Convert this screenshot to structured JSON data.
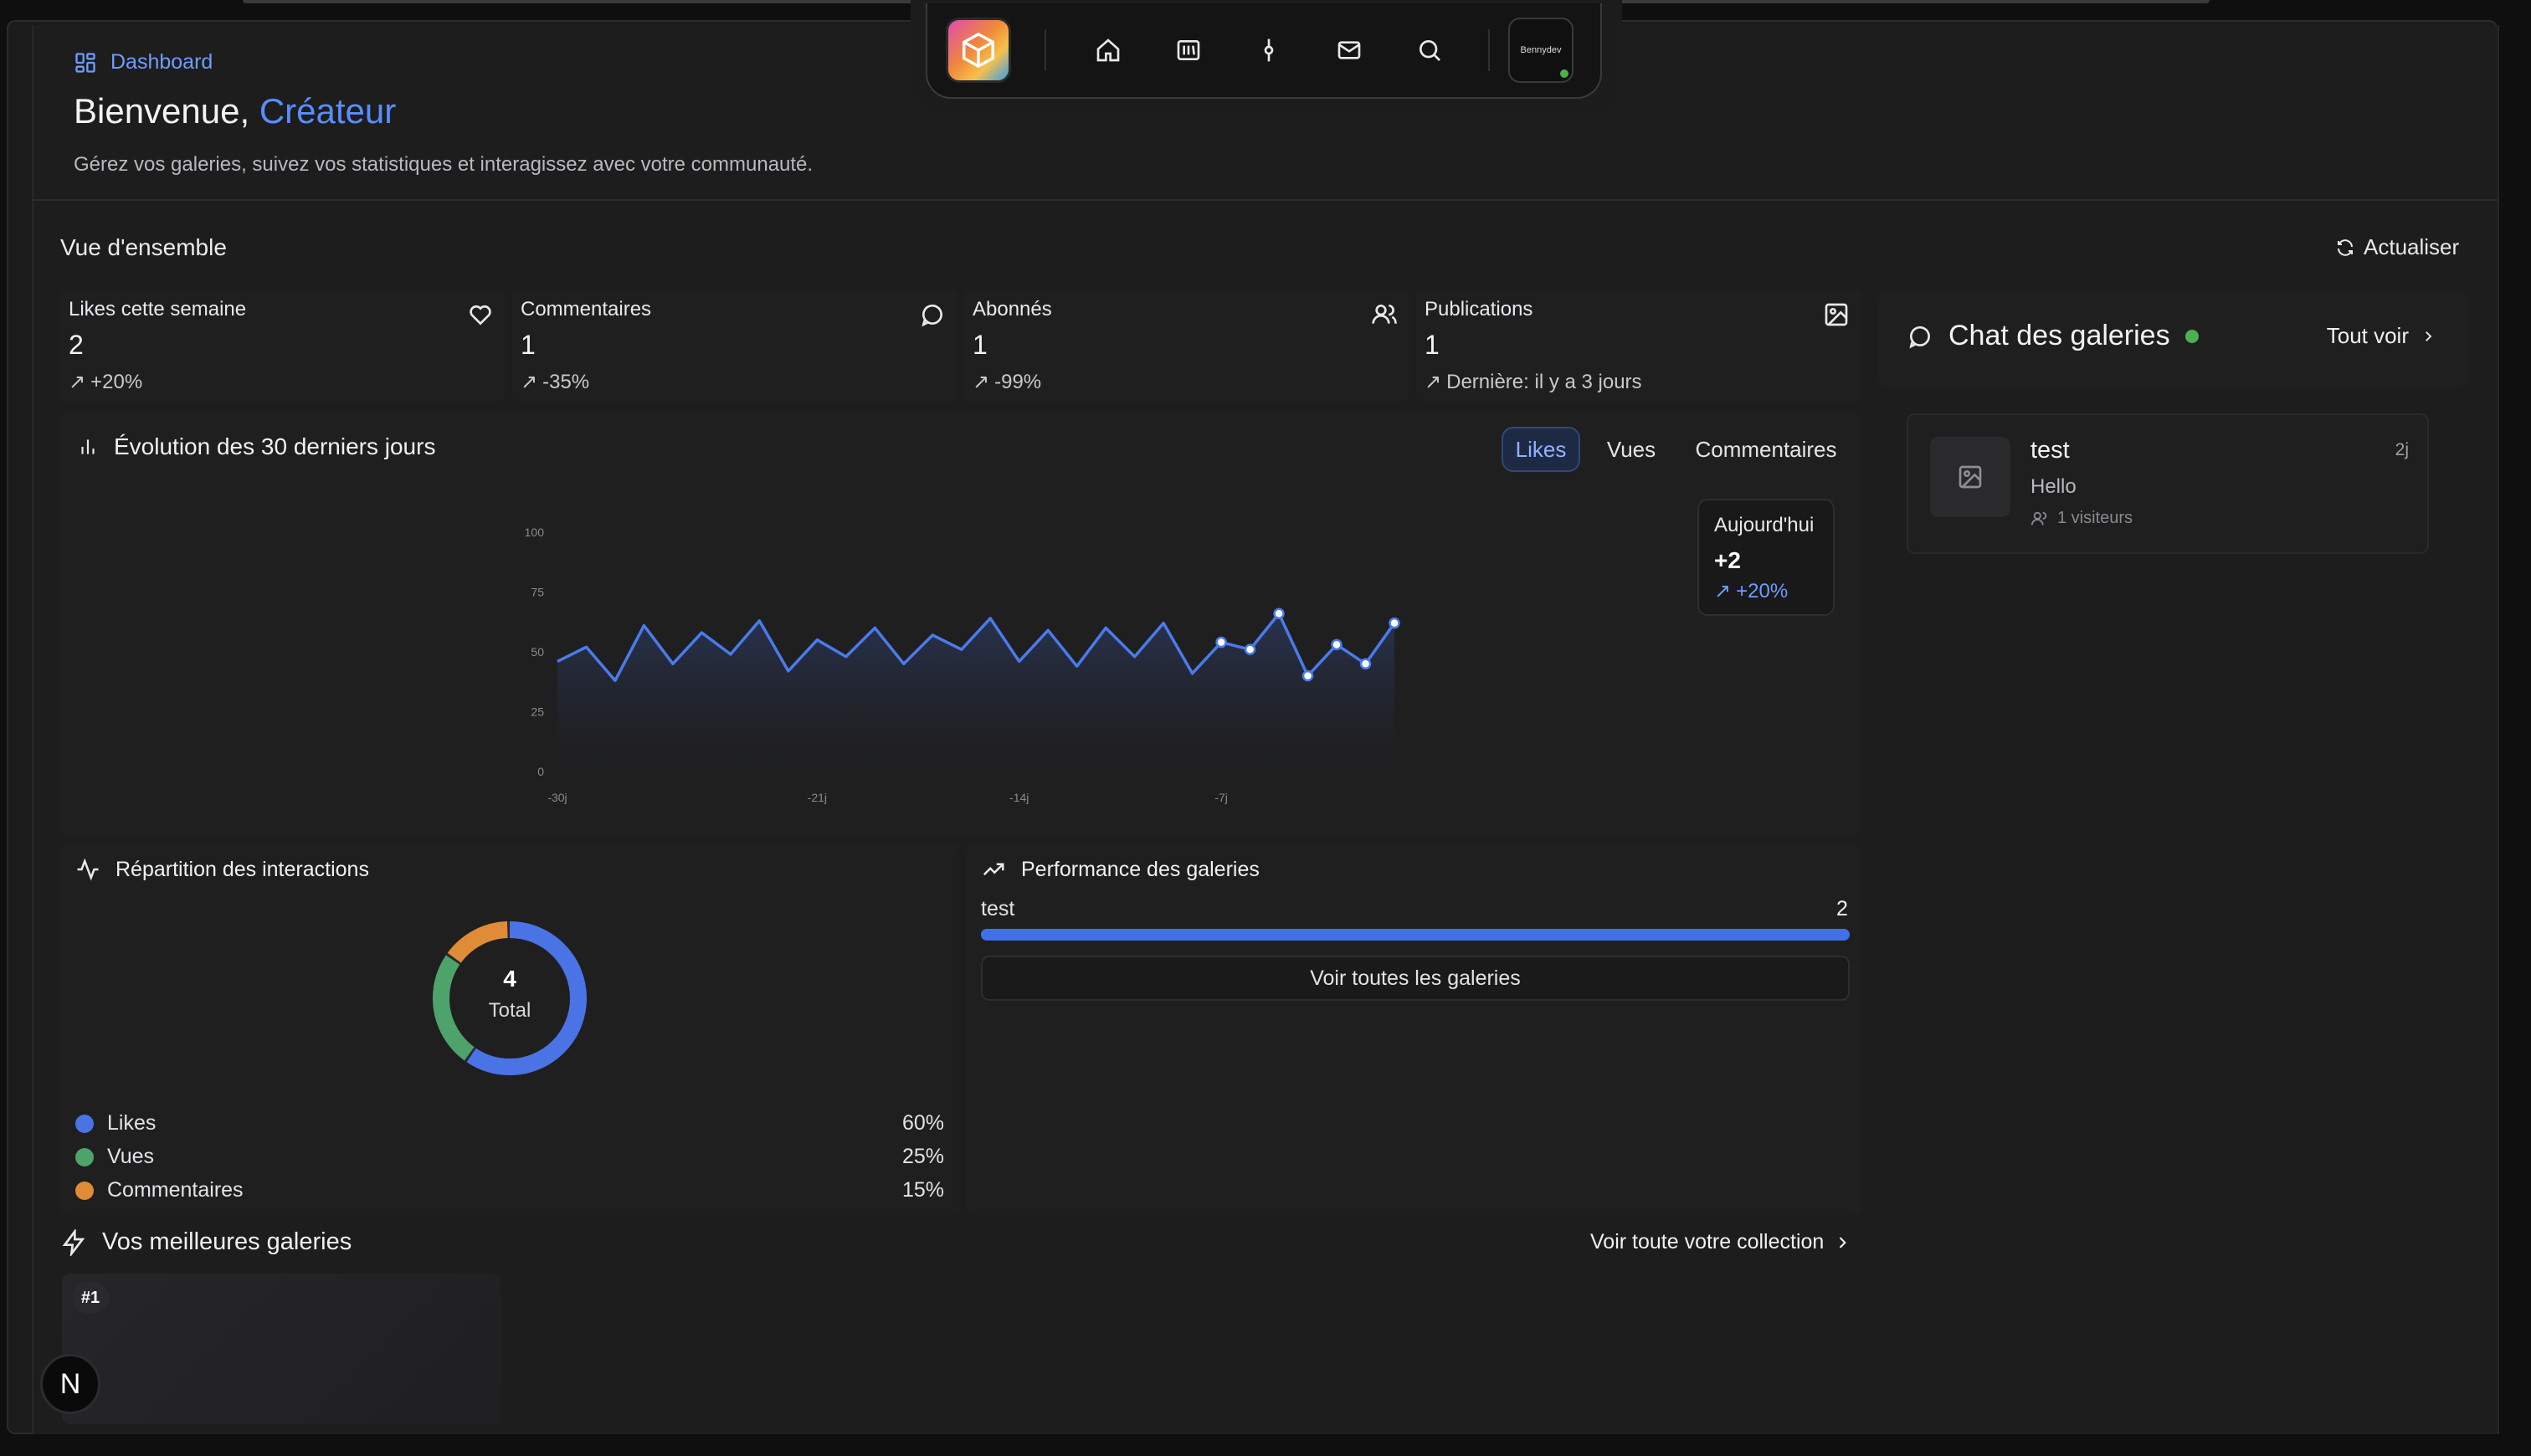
{
  "breadcrumb": {
    "label": "Dashboard"
  },
  "header": {
    "welcome_prefix": "Bienvenue,",
    "welcome_name": "Créateur",
    "subtitle": "Gérez vos galeries, suivez vos statistiques et interagissez avec votre communauté."
  },
  "dock": {
    "items": [
      "home-icon",
      "library-icon",
      "commit-icon",
      "mail-icon",
      "search-icon"
    ],
    "avatar_text": "Bennydev"
  },
  "overview": {
    "title": "Vue d'ensemble",
    "refresh_label": "Actualiser"
  },
  "stats": [
    {
      "label": "Likes cette semaine",
      "value": "2",
      "delta": "+20%",
      "icon": "heart-icon"
    },
    {
      "label": "Commentaires",
      "value": "1",
      "delta": "-35%",
      "icon": "comment-icon"
    },
    {
      "label": "Abonnés",
      "value": "1",
      "delta": "-99%",
      "icon": "users-icon"
    },
    {
      "label": "Publications",
      "value": "1",
      "delta": "Dernière: il y a 3 jours",
      "icon": "image-icon"
    }
  ],
  "evolution": {
    "title": "Évolution des 30 derniers jours",
    "tabs": [
      "Likes",
      "Vues",
      "Commentaires"
    ],
    "active_tab": "Likes",
    "today": {
      "label": "Aujourd'hui",
      "value": "+2",
      "delta": "+20%"
    }
  },
  "chart_data": {
    "type": "area",
    "title": "",
    "xlabel": "",
    "ylabel": "",
    "ylim": [
      0,
      100
    ],
    "y_ticks": [
      "0",
      "25",
      "50",
      "75",
      "100"
    ],
    "x_ticks": [
      {
        "label": "-30j",
        "x": 0
      },
      {
        "label": "-21j",
        "x": 9
      },
      {
        "label": "-14j",
        "x": 16
      },
      {
        "label": "-7j",
        "x": 23
      }
    ],
    "x": [
      0,
      1,
      2,
      3,
      4,
      5,
      6,
      7,
      8,
      9,
      10,
      11,
      12,
      13,
      14,
      15,
      16,
      17,
      18,
      19,
      20,
      21,
      22,
      23,
      24,
      25,
      26,
      27,
      28,
      29
    ],
    "values": [
      46,
      52,
      38,
      61,
      45,
      58,
      49,
      63,
      42,
      55,
      48,
      60,
      45,
      57,
      51,
      64,
      46,
      59,
      44,
      60,
      48,
      62,
      41,
      54,
      51,
      66,
      40,
      53,
      45,
      62
    ],
    "highlighted_from": 23,
    "color": "#4a7bec"
  },
  "interactions": {
    "title": "Répartition des interactions",
    "total_value": "4",
    "total_label": "Total",
    "legend": [
      {
        "label": "Likes",
        "pct": "60%",
        "value": 60,
        "color": "#4a74e6"
      },
      {
        "label": "Vues",
        "pct": "25%",
        "value": 25,
        "color": "#4da36a"
      },
      {
        "label": "Commentaires",
        "pct": "15%",
        "value": 15,
        "color": "#e08b36"
      }
    ]
  },
  "performance": {
    "title": "Performance des galeries",
    "items": [
      {
        "name": "test",
        "value": "2",
        "fill": 1.0
      }
    ],
    "see_all": "Voir toutes les galeries"
  },
  "best": {
    "title": "Vos meilleures galeries",
    "link": "Voir toute votre collection",
    "rank": "#1"
  },
  "chat": {
    "title": "Chat des galeries",
    "see_all": "Tout voir",
    "item": {
      "name": "test",
      "message": "Hello",
      "visitors": "1 visiteurs",
      "time": "2j"
    }
  },
  "next_badge": "N"
}
